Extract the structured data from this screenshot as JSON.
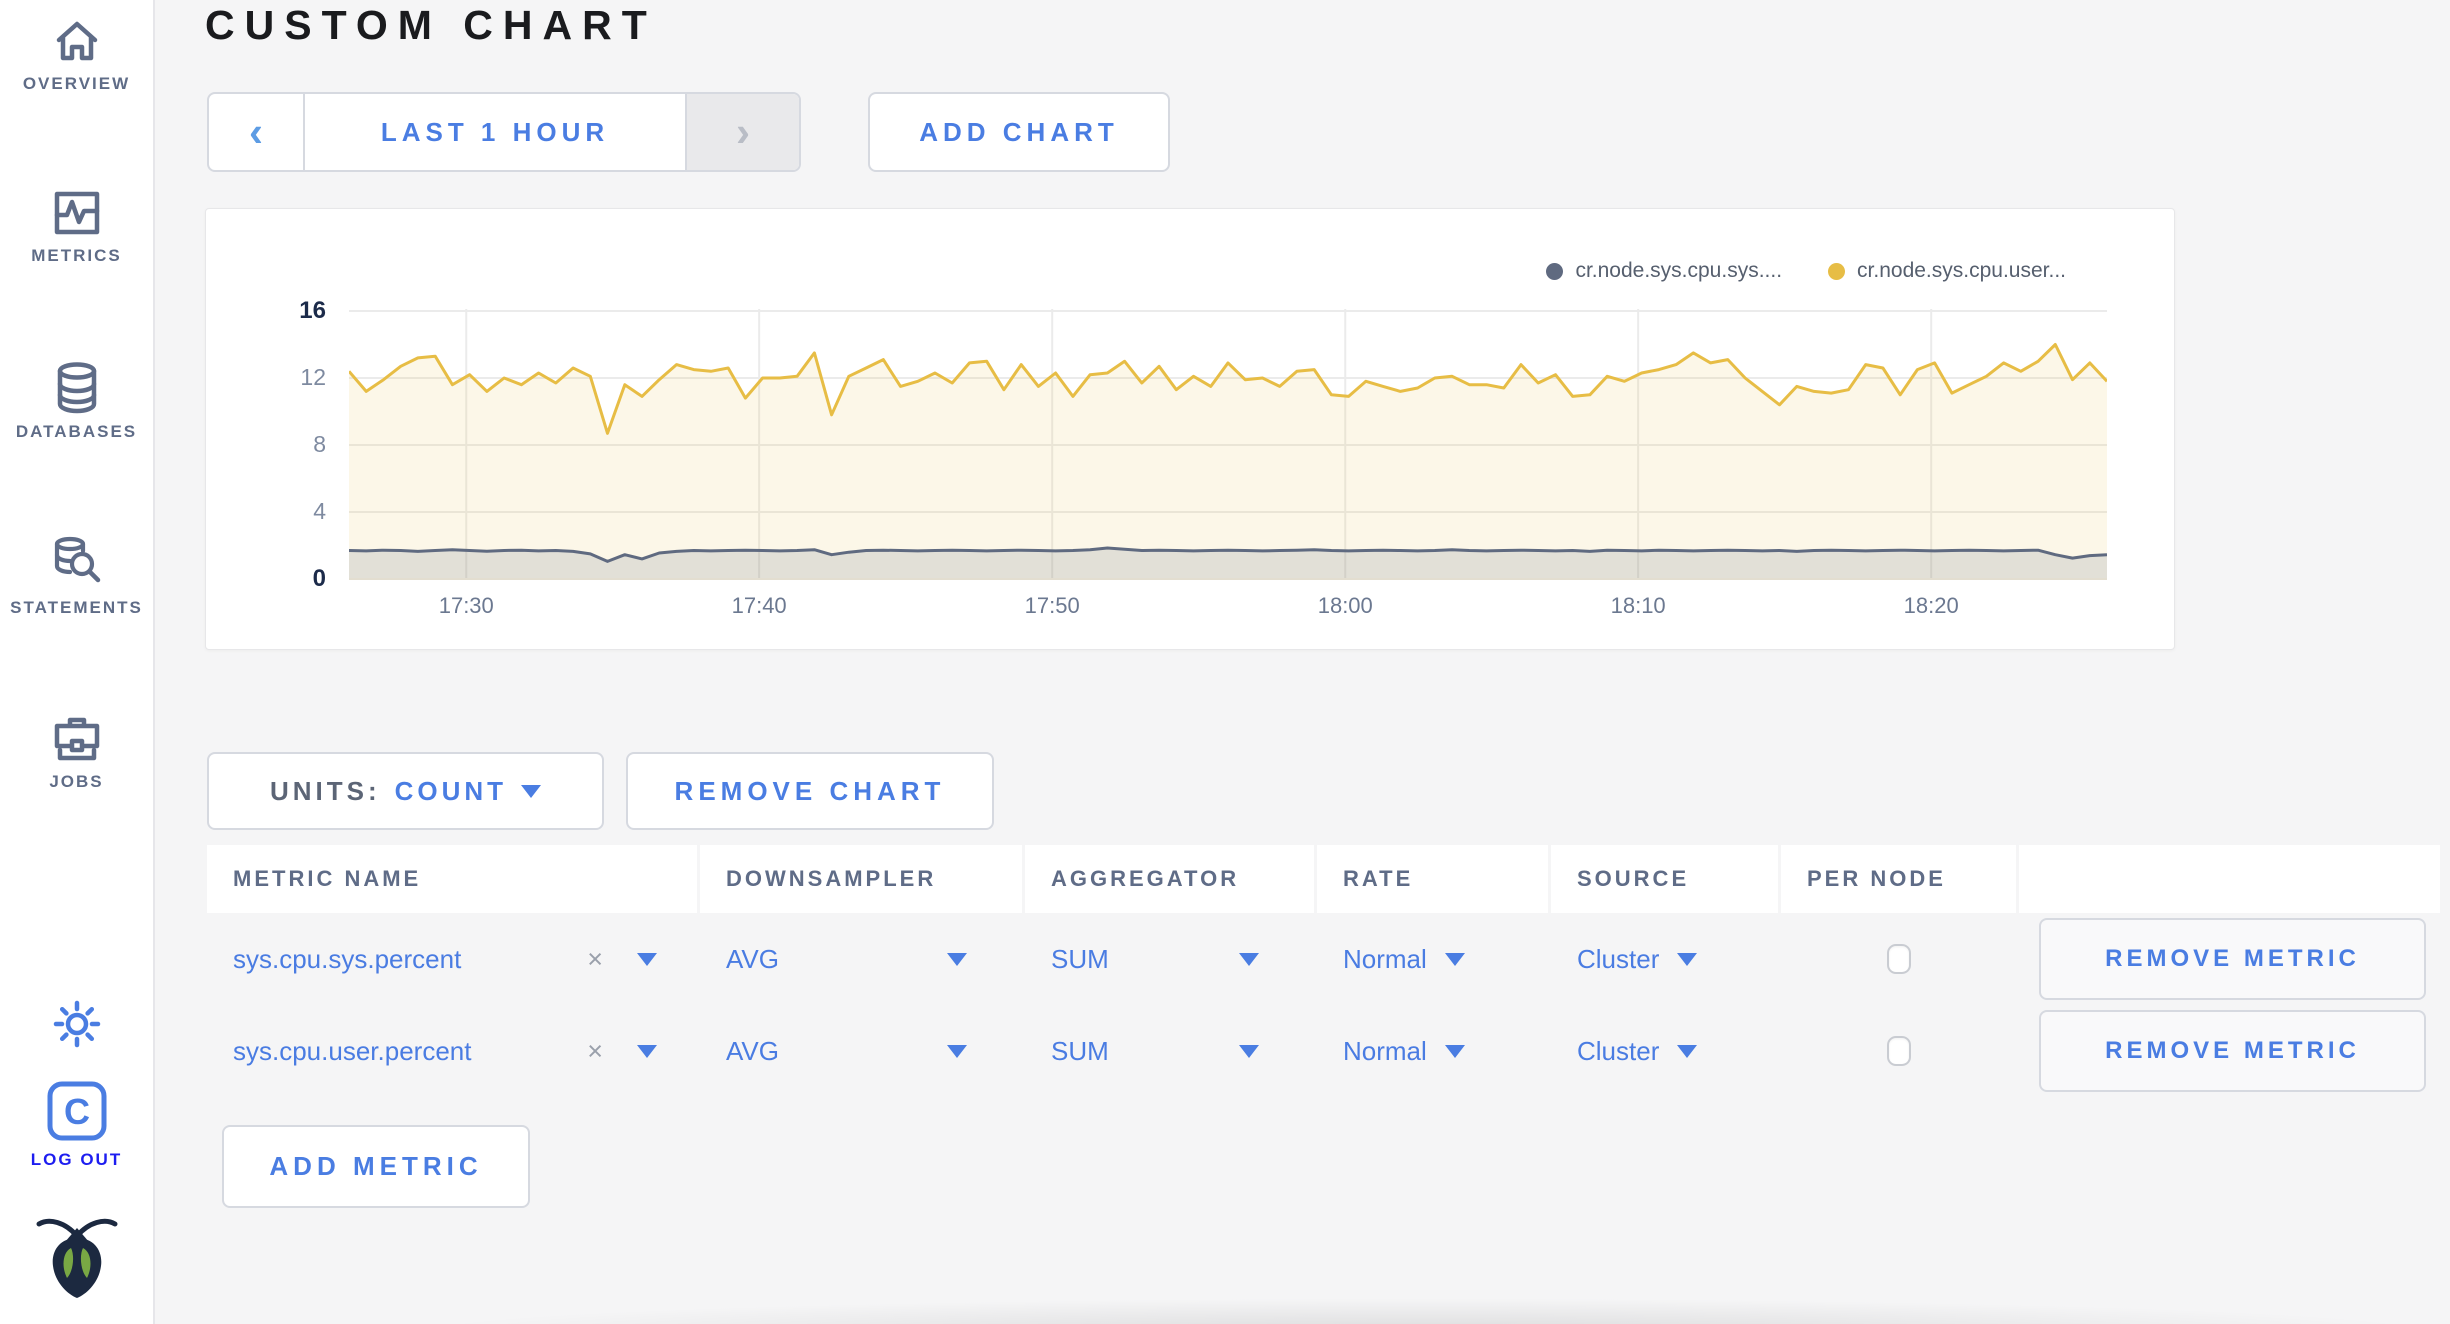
{
  "header": {
    "title": "CUSTOM CHART"
  },
  "toolbar": {
    "time_range_label": "LAST 1 HOUR",
    "prev_icon": "‹",
    "next_icon": "›",
    "add_chart_label": "ADD CHART"
  },
  "sidebar": {
    "items": [
      {
        "label": "OVERVIEW",
        "icon": "home-icon"
      },
      {
        "label": "METRICS",
        "icon": "metrics-icon"
      },
      {
        "label": "DATABASES",
        "icon": "database-icon"
      },
      {
        "label": "STATEMENTS",
        "icon": "statements-icon"
      },
      {
        "label": "JOBS",
        "icon": "jobs-icon"
      }
    ],
    "logout": {
      "label": "LOG OUT",
      "badge_letter": "C"
    }
  },
  "chart_controls": {
    "units_caption": "UNITS:",
    "units_value": "COUNT",
    "remove_chart_label": "REMOVE CHART"
  },
  "table": {
    "columns": [
      "METRIC NAME",
      "DOWNSAMPLER",
      "AGGREGATOR",
      "RATE",
      "SOURCE",
      "PER NODE",
      ""
    ],
    "rows": [
      {
        "metric_name": "sys.cpu.sys.percent",
        "clear": "×",
        "downsampler": "AVG",
        "aggregator": "SUM",
        "rate": "Normal",
        "source": "Cluster",
        "per_node_checked": false,
        "remove_label": "REMOVE METRIC"
      },
      {
        "metric_name": "sys.cpu.user.percent",
        "clear": "×",
        "downsampler": "AVG",
        "aggregator": "SUM",
        "rate": "Normal",
        "source": "Cluster",
        "per_node_checked": false,
        "remove_label": "REMOVE METRIC"
      }
    ],
    "add_metric_label": "ADD METRIC"
  },
  "chart_data": {
    "type": "area",
    "title": "",
    "xlabel": "",
    "ylabel": "",
    "x_range": [
      "17:26",
      "18:26"
    ],
    "ylim": [
      0,
      16.6
    ],
    "y_ticks": [
      0,
      4,
      8,
      12,
      16
    ],
    "x_tick_labels": [
      "17:30",
      "17:40",
      "17:50",
      "18:00",
      "18:10",
      "18:20"
    ],
    "x_tick_fracs": [
      0.0667,
      0.2333,
      0.4,
      0.5667,
      0.7333,
      0.9
    ],
    "grid": true,
    "legend_position": "top-right",
    "series": [
      {
        "name": "cr.node.sys.cpu.sys....",
        "color": "#5f6a80",
        "fill": "rgba(95,106,128,0.16)",
        "values": [
          1.7,
          1.68,
          1.72,
          1.7,
          1.65,
          1.7,
          1.75,
          1.7,
          1.66,
          1.7,
          1.72,
          1.68,
          1.7,
          1.65,
          1.5,
          1.05,
          1.45,
          1.2,
          1.55,
          1.65,
          1.7,
          1.68,
          1.7,
          1.72,
          1.7,
          1.68,
          1.7,
          1.75,
          1.45,
          1.6,
          1.7,
          1.72,
          1.7,
          1.68,
          1.7,
          1.72,
          1.7,
          1.68,
          1.7,
          1.72,
          1.7,
          1.68,
          1.7,
          1.75,
          1.85,
          1.78,
          1.7,
          1.72,
          1.7,
          1.68,
          1.7,
          1.72,
          1.7,
          1.68,
          1.7,
          1.72,
          1.75,
          1.7,
          1.68,
          1.7,
          1.72,
          1.7,
          1.68,
          1.7,
          1.75,
          1.7,
          1.68,
          1.7,
          1.72,
          1.7,
          1.68,
          1.7,
          1.65,
          1.72,
          1.7,
          1.68,
          1.72,
          1.7,
          1.68,
          1.7,
          1.72,
          1.7,
          1.68,
          1.7,
          1.65,
          1.7,
          1.72,
          1.7,
          1.68,
          1.7,
          1.72,
          1.7,
          1.68,
          1.7,
          1.72,
          1.7,
          1.68,
          1.7,
          1.72,
          1.45,
          1.25,
          1.4,
          1.45
        ]
      },
      {
        "name": "cr.node.sys.cpu.user...",
        "color": "#e7bd45",
        "fill": "rgba(231,189,69,0.12)",
        "values": [
          12.4,
          11.2,
          11.9,
          12.7,
          13.2,
          13.3,
          11.6,
          12.2,
          11.2,
          12.0,
          11.6,
          12.3,
          11.7,
          12.6,
          12.1,
          8.7,
          11.6,
          10.9,
          11.9,
          12.8,
          12.5,
          12.4,
          12.6,
          10.8,
          12.0,
          12.0,
          12.1,
          13.5,
          9.8,
          12.1,
          12.6,
          13.1,
          11.5,
          11.8,
          12.3,
          11.7,
          12.9,
          13.0,
          11.3,
          12.8,
          11.5,
          12.3,
          10.9,
          12.2,
          12.3,
          13.0,
          11.7,
          12.7,
          11.3,
          12.1,
          11.5,
          12.9,
          11.9,
          12.0,
          11.5,
          12.4,
          12.5,
          11.0,
          10.9,
          11.8,
          11.5,
          11.2,
          11.4,
          12.0,
          12.1,
          11.6,
          11.6,
          11.4,
          12.8,
          11.7,
          12.2,
          10.9,
          11.0,
          12.1,
          11.8,
          12.3,
          12.5,
          12.8,
          13.5,
          12.9,
          13.1,
          12.0,
          11.2,
          10.4,
          11.5,
          11.2,
          11.1,
          11.3,
          12.8,
          12.6,
          11.0,
          12.5,
          12.9,
          11.1,
          11.6,
          12.1,
          12.9,
          12.4,
          13.0,
          14.0,
          11.9,
          12.9,
          11.8
        ]
      }
    ]
  }
}
